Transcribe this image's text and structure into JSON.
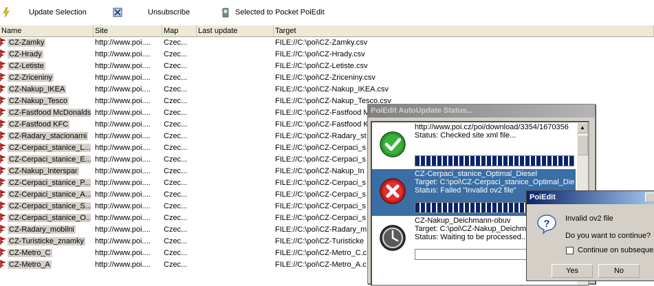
{
  "toolbar": {
    "update_label": "Update Selection",
    "unsubscribe_label": "Unsubscribe",
    "pocket_label": "Selected to Pocket PoiEdit"
  },
  "columns": {
    "name": "Name",
    "site": "Site",
    "map": "Map",
    "last_update": "Last update",
    "target": "Target"
  },
  "rows": [
    {
      "name": "CZ-Zamky",
      "site": "http://www.poi....",
      "map": "Czec...",
      "last_update": "",
      "target": "FILE://C:\\poi\\CZ-Zamky.csv"
    },
    {
      "name": "CZ-Hrady",
      "site": "http://www.poi....",
      "map": "Czec...",
      "last_update": "",
      "target": "FILE://C:\\poi\\CZ-Hrady.csv"
    },
    {
      "name": "CZ-Letiste",
      "site": "http://www.poi....",
      "map": "Czec...",
      "last_update": "",
      "target": "FILE://C:\\poi\\CZ-Letiste.csv"
    },
    {
      "name": "CZ-Zriceniny",
      "site": "http://www.poi....",
      "map": "Czec...",
      "last_update": "",
      "target": "FILE://C:\\poi\\CZ-Zriceniny.csv"
    },
    {
      "name": "CZ-Nakup_IKEA",
      "site": "http://www.poi....",
      "map": "Czec...",
      "last_update": "",
      "target": "FILE://C:\\poi\\CZ-Nakup_IKEA.csv"
    },
    {
      "name": "CZ-Nakup_Tesco",
      "site": "http://www.poi....",
      "map": "Czec...",
      "last_update": "",
      "target": "FILE://C:\\poi\\CZ-Nakup_Tesco.csv"
    },
    {
      "name": "CZ-Fastfood McDonalds",
      "site": "http://www.poi....",
      "map": "Czec...",
      "last_update": "",
      "target": "FILE://C:\\poi\\CZ-Fastfood M"
    },
    {
      "name": "CZ-Fastfood KFC",
      "site": "http://www.poi....",
      "map": "Czec...",
      "last_update": "",
      "target": "FILE://C:\\poi\\CZ-Fastfood K"
    },
    {
      "name": "CZ-Radary_stacionarni",
      "site": "http://www.poi....",
      "map": "Czec...",
      "last_update": "",
      "target": "FILE://C:\\poi\\CZ-Radary_st"
    },
    {
      "name": "CZ-Cerpaci_stanice_L...",
      "site": "http://www.poi....",
      "map": "Czec...",
      "last_update": "",
      "target": "FILE://C:\\poi\\CZ-Cerpaci_s"
    },
    {
      "name": "CZ-Cerpaci_stanice_E...",
      "site": "http://www.poi....",
      "map": "Czec...",
      "last_update": "",
      "target": "FILE://C:\\poi\\CZ-Cerpaci_s"
    },
    {
      "name": "CZ-Nakup_Interspar",
      "site": "http://www.poi....",
      "map": "Czec...",
      "last_update": "",
      "target": "FILE://C:\\poi\\CZ-Nakup_In"
    },
    {
      "name": "CZ-Cerpaci_stanice_P...",
      "site": "http://www.poi....",
      "map": "Czec...",
      "last_update": "",
      "target": "FILE://C:\\poi\\CZ-Cerpaci_s"
    },
    {
      "name": "CZ-Cerpaci_stanice_A...",
      "site": "http://www.poi....",
      "map": "Czec...",
      "last_update": "",
      "target": "FILE://C:\\poi\\CZ-Cerpaci_s"
    },
    {
      "name": "CZ-Cerpaci_stanice_S...",
      "site": "http://www.poi....",
      "map": "Czec...",
      "last_update": "",
      "target": "FILE://C:\\poi\\CZ-Cerpaci_s"
    },
    {
      "name": "CZ-Cerpaci_stanice_O...",
      "site": "http://www.poi....",
      "map": "Czec...",
      "last_update": "",
      "target": "FILE://C:\\poi\\CZ-Cerpaci_s"
    },
    {
      "name": "CZ-Radary_mobilni",
      "site": "http://www.poi....",
      "map": "Czec...",
      "last_update": "",
      "target": "FILE://C:\\poi\\CZ-Radary_m"
    },
    {
      "name": "CZ-Turisticke_znamky",
      "site": "http://www.poi....",
      "map": "Czec...",
      "last_update": "",
      "target": "FILE://C:\\poi\\CZ-Turisticke"
    },
    {
      "name": "CZ-Metro_C",
      "site": "http://www.poi....",
      "map": "Czec...",
      "last_update": "",
      "target": "FILE://C:\\poi\\CZ-Metro_C.c"
    },
    {
      "name": "CZ-Metro_A",
      "site": "http://www.poi....",
      "map": "Czec...",
      "last_update": "",
      "target": "FILE://C:\\poi\\CZ-Metro_A.c"
    }
  ],
  "status_dialog": {
    "title": "PoiEdit AutoUpdate Status...",
    "entries": [
      {
        "line1": "http://www.poi.cz/poi/download/3354/1670356",
        "line2": "Status: Checked site xml file...",
        "line3": "",
        "progress": 1.0,
        "icon": "check-icon"
      },
      {
        "line1": "CZ-Cerpaci_stanice_Optimal_Diesel",
        "line2": "Target: C:\\poi\\CZ-Cerpaci_stanice_Optimal_Die",
        "line3": "Status: Failed \"Invalid ov2 file\"",
        "progress": 1.0,
        "icon": "error-icon"
      },
      {
        "line1": "CZ-Nakup_Deichmann-obuv",
        "line2": "Target: C:\\poi\\CZ-Nakup_Deichm",
        "line3": "Status: Waiting to be processed...",
        "progress": 0.0,
        "icon": "clock-icon"
      }
    ]
  },
  "confirm_dialog": {
    "title": "PoiEdit",
    "message": "Invalid ov2 file",
    "question": "Do you want to continue?",
    "checkbox_label": "Continue on subsequent",
    "yes_label": "Yes",
    "no_label": "No"
  }
}
